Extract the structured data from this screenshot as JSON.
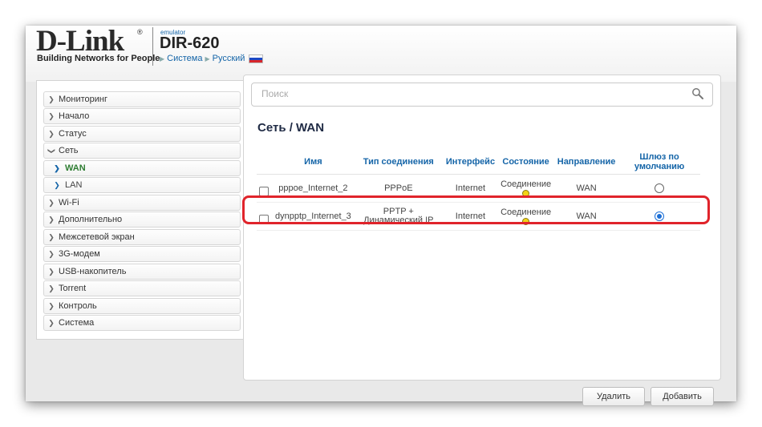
{
  "header": {
    "brand": "D-Link",
    "registered": "®",
    "tagline": "Building Networks for People",
    "emulator_label": "emulator",
    "model": "DIR-620",
    "crumb_system": "Система",
    "crumb_language": "Русский"
  },
  "sidebar": {
    "items": [
      {
        "label": "Мониторинг",
        "icon": "chevron-right-icon"
      },
      {
        "label": "Начало",
        "icon": "chevron-right-icon"
      },
      {
        "label": "Статус",
        "icon": "chevron-right-icon"
      },
      {
        "label": "Сеть",
        "icon": "chevron-down-icon"
      },
      {
        "label": "WAN",
        "icon": "chevron-right-icon",
        "active": true
      },
      {
        "label": "LAN",
        "icon": "chevron-right-icon"
      },
      {
        "label": "Wi-Fi",
        "icon": "chevron-right-icon"
      },
      {
        "label": "Дополнительно",
        "icon": "chevron-right-icon"
      },
      {
        "label": "Межсетевой экран",
        "icon": "chevron-right-icon"
      },
      {
        "label": "3G-модем",
        "icon": "chevron-right-icon"
      },
      {
        "label": "USB-накопитель",
        "icon": "chevron-right-icon"
      },
      {
        "label": "Torrent",
        "icon": "chevron-right-icon"
      },
      {
        "label": "Контроль",
        "icon": "chevron-right-icon"
      },
      {
        "label": "Система",
        "icon": "chevron-right-icon"
      }
    ]
  },
  "search": {
    "placeholder": "Поиск",
    "icon": "search-icon"
  },
  "page_title": "Сеть /  WAN",
  "table": {
    "headers": [
      "Имя",
      "Тип соединения",
      "Интерфейс",
      "Состояние",
      "Направление",
      "Шлюз по умолчанию"
    ],
    "rows": [
      {
        "name": "pppoe_Internet_2",
        "type": "PPPoE",
        "interface": "Internet",
        "state": "Соединение",
        "direction": "WAN",
        "default_gateway": false,
        "checked": false
      },
      {
        "name": "dynpptp_Internet_3",
        "type": "PPTP + Динамический IP",
        "interface": "Internet",
        "state": "Соединение",
        "direction": "WAN",
        "default_gateway": true,
        "checked": false
      }
    ]
  },
  "buttons": {
    "delete": "Удалить",
    "add": "Добавить"
  },
  "colors": {
    "accent": "#1565a8",
    "active_menu": "#2e7d32",
    "status_dot": "#f2d317",
    "highlight": "#e0242b"
  }
}
